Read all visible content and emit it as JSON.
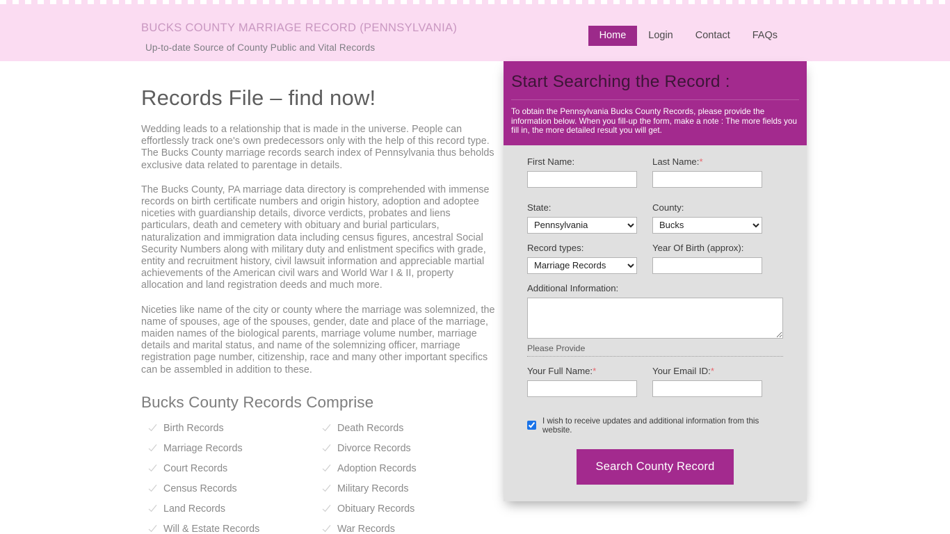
{
  "header": {
    "brand_title": "BUCKS COUNTY MARRIAGE RECORD (PENNSYLVANIA)",
    "brand_subtitle": "Up-to-date Source of  County Public and Vital Records",
    "nav": [
      {
        "label": "Home",
        "active": true
      },
      {
        "label": "Login",
        "active": false
      },
      {
        "label": "Contact",
        "active": false
      },
      {
        "label": "FAQs",
        "active": false
      }
    ]
  },
  "content": {
    "title": "Records File – find now!",
    "paragraphs": [
      "Wedding leads to a relationship that is made in the universe. People can effortlessly track one's own predecessors only with the help of this record type. The Bucks County marriage records search index of Pennsylvania thus beholds exclusive data related to parentage in details.",
      "The Bucks County, PA marriage data directory is comprehended with immense records on birth certificate numbers and origin history, adoption and adoptee niceties with guardianship details, divorce verdicts, probates and liens particulars, death and cemetery with obituary and burial particulars, naturalization and immigration data including census figures, ancestral Social Security Numbers along with military duty and enlistment specifics with grade, entity and recruitment history, civil lawsuit information and appreciable martial achievements of the American civil wars and World War I & II, property allocation and land registration deeds and much more.",
      "Niceties like name of the city or county where the marriage was solemnized, the name of spouses, age of the spouses, gender, date and place of the marriage, maiden names of the biological parents, marriage volume number, marriage details and marital status, and name of the solemnizing officer, marriage registration page number, citizenship, race and many other important specifics can be assembled in addition to these."
    ],
    "records_section_title": "Bucks County Records Comprise",
    "records": [
      "Birth Records",
      "Death Records",
      "Marriage Records",
      "Divorce Records",
      "Court Records",
      "Adoption Records",
      "Census Records",
      "Military Records",
      "Land Records",
      "Obituary Records",
      "Will & Estate Records",
      "War Records"
    ]
  },
  "form": {
    "panel_title": "Start Searching the Record :",
    "panel_description": "To obtain the Pennsylvania Bucks County Records, please provide the information below. When you fill-up the form, make a note : The more fields you fill in, the more detailed result you will get.",
    "first_name_label": "First Name:",
    "first_name_value": "",
    "last_name_label": "Last Name:",
    "last_name_required": "*",
    "last_name_value": "",
    "state_label": "State:",
    "state_value": "Pennsylvania",
    "county_label": "County:",
    "county_value": "Bucks",
    "record_types_label": "Record types:",
    "record_types_value": "Marriage Records",
    "year_of_birth_label": "Year Of Birth (approx):",
    "year_of_birth_value": "",
    "additional_info_label": "Additional Information:",
    "additional_info_value": "",
    "please_provide": "Please Provide",
    "full_name_label": "Your Full Name:",
    "full_name_required": "*",
    "full_name_value": "",
    "email_label": "Your Email ID:",
    "email_required": "*",
    "email_value": "",
    "consent_label": "I wish to receive updates and additional information from this website.",
    "consent_checked": true,
    "submit_label": "Search County Record"
  },
  "colors": {
    "brand_magenta": "#a32a8e",
    "nav_active": "#9c2a8a",
    "header_pink": "#fbdcf2",
    "panel_gray": "#e0e0e0",
    "required_red": "#e8656c",
    "checkbox_blue": "#1a73e8"
  }
}
